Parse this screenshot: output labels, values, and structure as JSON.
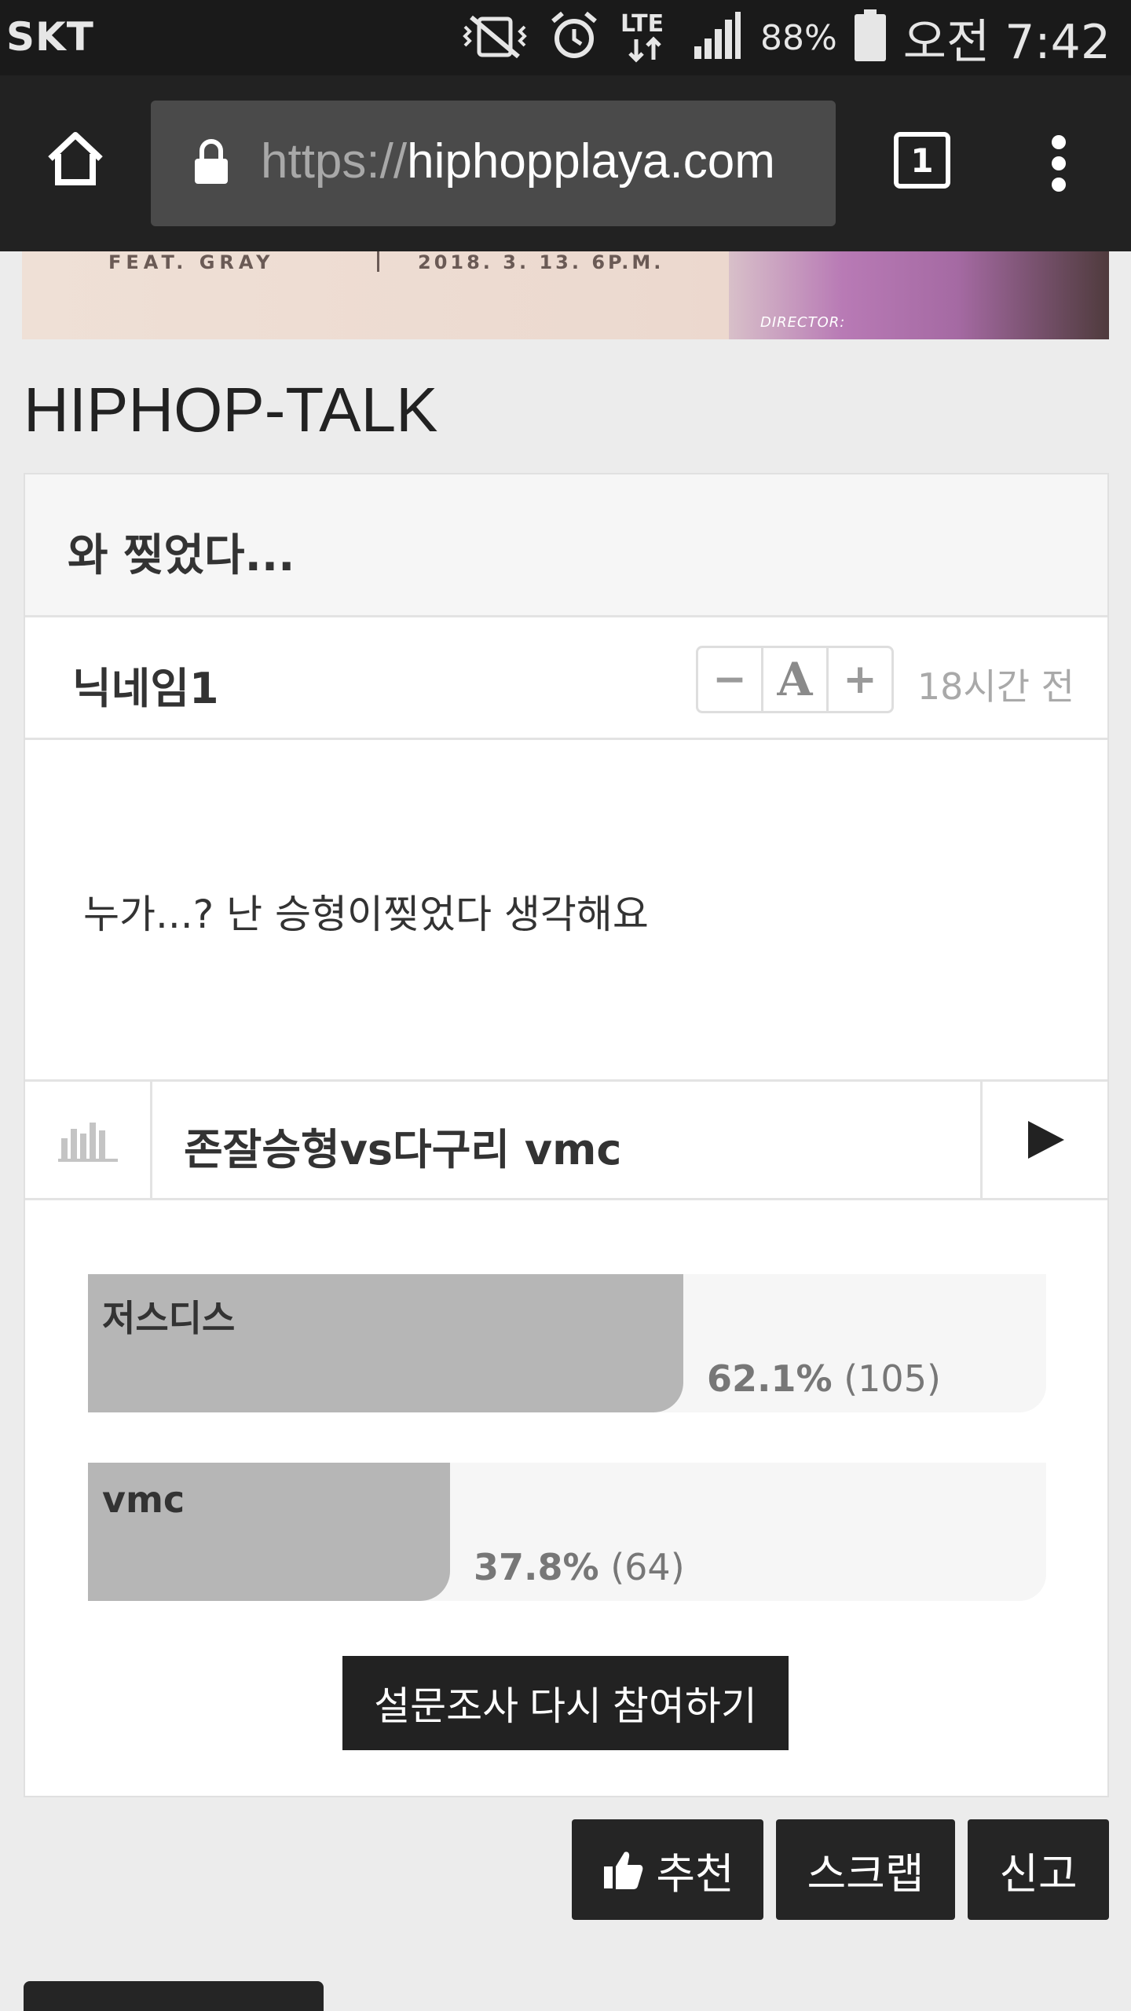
{
  "status_bar": {
    "carrier": "SKT",
    "network": "LTE",
    "battery": "88%",
    "time": "오전 7:42",
    "icons": [
      "vibrate-icon",
      "alarm-icon",
      "lte-data-icon",
      "signal-icon",
      "battery-icon"
    ]
  },
  "browser": {
    "url_protocol": "https://",
    "url_host": "hiphopplaya.com",
    "tab_count": "1",
    "icons": [
      "home-icon",
      "lock-icon",
      "tabs-icon",
      "overflow-menu-icon"
    ]
  },
  "banner": {
    "text_left": "FEAT. GRAY",
    "text_date": "2018. 3. 13.   6P.M.",
    "text_tag": "DIRECTOR:"
  },
  "board": {
    "title": "HIPHOP-TALK"
  },
  "post": {
    "title": "와 찢었다...",
    "author": "닉네임1",
    "time_ago": "18시간 전",
    "font_controls": {
      "decrease": "−",
      "font": "A",
      "increase": "+"
    },
    "body": "누가...? 난 승형이찢었다 생각해요"
  },
  "poll": {
    "question": "존잘승형vs다구리 vmc",
    "options": [
      {
        "label": "저스디스",
        "percent": "62.1%",
        "count": "(105)",
        "ratio": 0.621
      },
      {
        "label": "vmc",
        "percent": "37.8%",
        "count": "(64)",
        "ratio": 0.378
      }
    ],
    "retake_label": "설문조사 다시 참여하기"
  },
  "actions": {
    "recommend": "추천",
    "scrap": "스크랩",
    "report": "신고"
  },
  "colors": {
    "status_bar_bg": "#1a1a1a",
    "browser_bar_bg": "#222222",
    "url_box_bg": "#4a4a4a",
    "page_bg": "#ececec",
    "poll_fill": "#b6b6b6",
    "button_bg": "#252525"
  }
}
